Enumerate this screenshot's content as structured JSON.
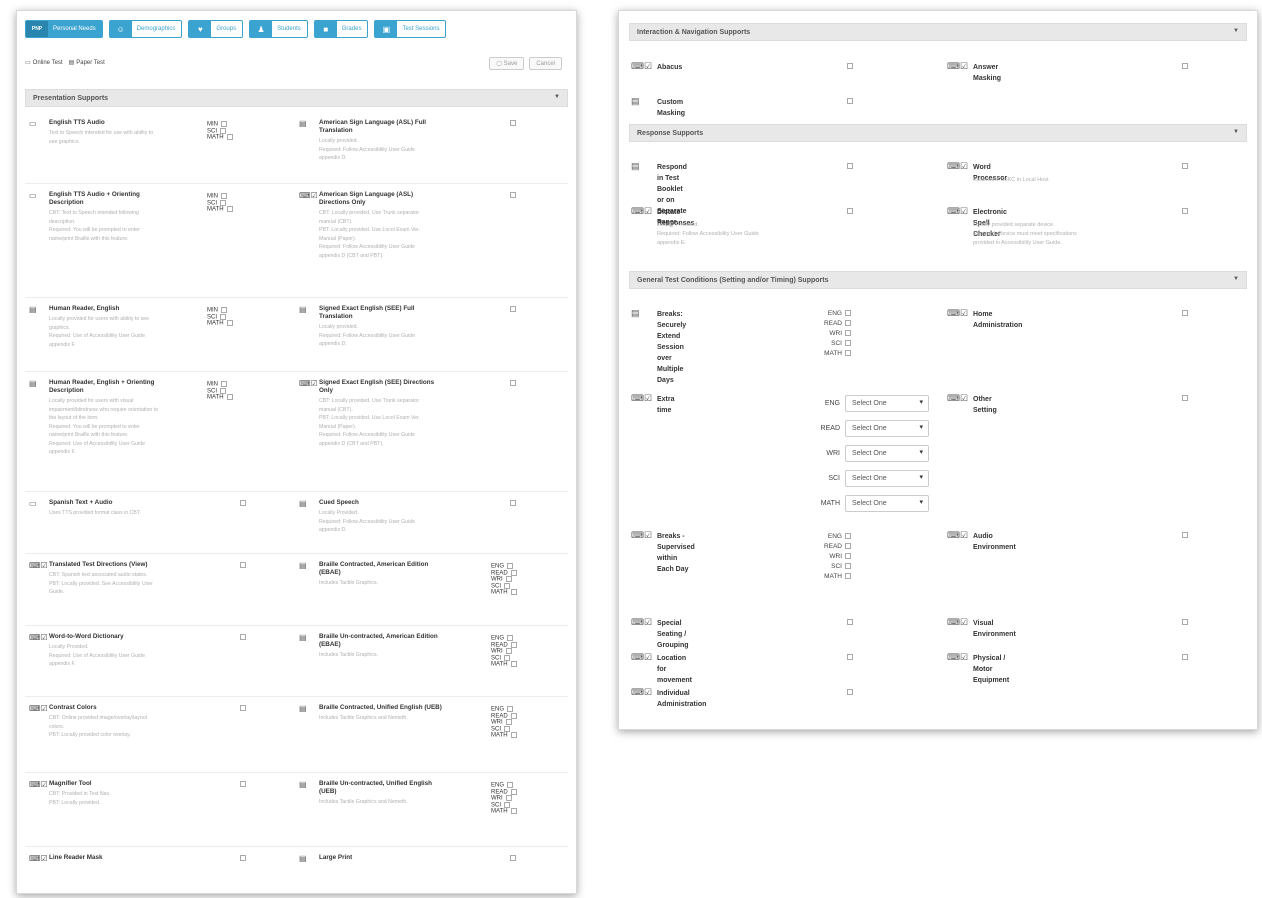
{
  "tabs": [
    {
      "label": "Personal Needs",
      "icon": "PNP",
      "active": true
    },
    {
      "label": "Demographics",
      "icon": "person-icon"
    },
    {
      "label": "Groups",
      "icon": "users-icon"
    },
    {
      "label": "Students",
      "icon": "student-icon"
    },
    {
      "label": "Grades",
      "icon": "grades-icon"
    },
    {
      "label": "Test Sessions",
      "icon": "session-icon"
    }
  ],
  "legend": {
    "online": "Online Test",
    "paper": "Paper Test"
  },
  "toolbar": {
    "save": "Save",
    "cancel": "Cancel"
  },
  "left": {
    "presentation_header": "Presentation Supports",
    "items": [
      {
        "title": "English TTS Audio",
        "desc": [
          "Text to Speech intended for use with ability to",
          "see graphics."
        ],
        "subs": [
          "MIN",
          "SCI",
          "MATH"
        ]
      },
      {
        "title": "American Sign Language (ASL) Full",
        "title2": "Translation",
        "desc": [
          "Locally provided.",
          "Required: Follow Accessibility User Guide",
          "appendix D."
        ]
      },
      {
        "title": "English TTS Audio + Orienting",
        "title2": "Description",
        "desc": [
          "CBT: Text to Speech intended following",
          "description.",
          "Required: You will be prompted to enter",
          "name/print Braille with this feature."
        ],
        "subs": [
          "MIN",
          "SCI",
          "MATH"
        ]
      },
      {
        "title": "American Sign Language (ASL)",
        "title2": "Directions Only",
        "desc": [
          "CBT: Locally provided. Use Trunk separator",
          "manual (CBT).",
          "PBT: Locally provided. Use Locol Exam Ver.",
          "Manual (Paper).",
          "Required: Follow Accessibility User Guide",
          "appendix D (CBT and PBT)."
        ]
      },
      {
        "title": "Human Reader, English",
        "desc": [
          "Locally provided for users with ability to see",
          "graphics.",
          "Required: Use of Accessibility User Guide",
          "appendix F."
        ],
        "subs": [
          "MIN",
          "SCI",
          "MATH"
        ]
      },
      {
        "title": "Signed Exact English (SEE) Full",
        "title2": "Translation",
        "desc": [
          "Locally provided.",
          "Required: Follow Accessibility User Guide",
          "appendix D."
        ]
      },
      {
        "title": "Human Reader, English + Orienting",
        "title2": "Description",
        "desc": [
          "Locally provided for users with visual",
          "impairment/blindness who require orientation to",
          "the layout of the item.",
          "Required: You will be prompted to enter",
          "name/print Braille with this feature.",
          "Required: Use of Accessibility User Guide",
          "appendix F."
        ],
        "subs": [
          "MIN",
          "SCI",
          "MATH"
        ]
      },
      {
        "title": "Signed Exact English (SEE) Directions",
        "title2": "Only",
        "desc": [
          "CBT: Locally provided. Use Trunk separator",
          "manual (CBT).",
          "PBT: Locally provided. Use Locol Exam Ver.",
          "Manual (Paper).",
          "Required: Follow Accessibility User Guide",
          "appendix D (CBT and PBT)."
        ]
      },
      {
        "title": "Spanish Text + Audio",
        "desc": [
          "Uses TTS provided format class in CBT."
        ]
      },
      {
        "title": "Cued Speech",
        "desc": [
          "Locally Provided.",
          "Required: Follow Accessibility User Guide",
          "appendix D."
        ]
      },
      {
        "title": "Translated Test Directions (View)",
        "desc": [
          "CBT: Spanish text associated audio states.",
          "PBT: Locally provided. See Accessibility User",
          "Guide."
        ]
      },
      {
        "title": "Braille Contracted, American Edition",
        "title2": "(EBAE)",
        "desc": [
          "Includes Tactile Graphics."
        ],
        "subs": [
          "ENG",
          "READ",
          "WRI",
          "SCI",
          "MATH"
        ]
      },
      {
        "title": "Word-to-Word Dictionary",
        "desc": [
          "Locally Provided.",
          "Required: Use of Accessibility User Guide",
          "appendix F."
        ]
      },
      {
        "title": "Braille Un-contracted, American Edition",
        "title2": "(EBAE)",
        "desc": [
          "Includes Tactile Graphics."
        ],
        "subs": [
          "ENG",
          "READ",
          "WRI",
          "SCI",
          "MATH"
        ]
      },
      {
        "title": "Contrast Colors",
        "desc": [
          "CBT: Online provided image/overlay/layout",
          "colors.",
          "PBT: Locally provided color overlay."
        ]
      },
      {
        "title": "Braille Contracted, Unified English (UEB)",
        "desc": [
          "Includes Tactile Graphics and Nemeth."
        ],
        "subs": [
          "ENG",
          "READ",
          "WRI",
          "SCI",
          "MATH"
        ]
      },
      {
        "title": "Magnifier Tool",
        "desc": [
          "CBT: Provided in Test Nav.",
          "PBT: Locally provided."
        ]
      },
      {
        "title": "Braille Un-contracted, Unified English",
        "title2": "(UEB)",
        "desc": [
          "Includes Tactile Graphics and Nemeth."
        ],
        "subs": [
          "ENG",
          "READ",
          "WRI",
          "SCI",
          "MATH"
        ]
      },
      {
        "title": "Line Reader Mask"
      },
      {
        "title": "Large Print"
      }
    ]
  },
  "right": {
    "interaction_header": "Interaction & Navigation Supports",
    "abacus": "Abacus",
    "answer_masking": "Answer Masking",
    "custom_masking": "Custom Masking",
    "response_header": "Response Supports",
    "respond_in_booklet": "Respond in Test Booklet or on Separate",
    "respond_in_booklet2": "Paper",
    "word_processor": "Word Processor",
    "word_processor_desc": "Restricted: SoKC in Local Host",
    "dictate": "Dictate Responses",
    "dictate_desc": [
      "Locally Provided.",
      "Required: Follow Accessibility User Guide",
      "appendix E."
    ],
    "spell_checker": "Electronic Spell Checker",
    "spell_checker_desc": [
      "Locally provided separate device.",
      "Required: Device must meet specifications",
      "provided in Accessibility User Guide."
    ],
    "general_header": "General Test Conditions (Setting and/or Timing) Supports",
    "breaks_extend": "Breaks: Securely Extend Session",
    "breaks_extend2": "over Multiple Days",
    "breaks_subs": [
      "ENG",
      "READ",
      "WRI",
      "SCI",
      "MATH"
    ],
    "home_admin": "Home Administration",
    "extra_time": "Extra time",
    "extra_time_rows": [
      {
        "label": "ENG",
        "value": "Select One"
      },
      {
        "label": "READ",
        "value": "Select One"
      },
      {
        "label": "WRI",
        "value": "Select One"
      },
      {
        "label": "SCI",
        "value": "Select One"
      },
      {
        "label": "MATH",
        "value": "Select One"
      }
    ],
    "other_setting": "Other Setting",
    "breaks_supervised": "Breaks - Supervised",
    "breaks_supervised2": "within Each Day",
    "supervised_subs": [
      "ENG",
      "READ",
      "WRI",
      "SCI",
      "MATH"
    ],
    "audio_env": "Audio Environment",
    "special_seating": "Special Seating / Grouping",
    "visual_env": "Visual Environment",
    "location_movement": "Location for movement",
    "physical_equipment": "Physical / Motor Equipment",
    "individual_admin": "Individual Administration"
  }
}
